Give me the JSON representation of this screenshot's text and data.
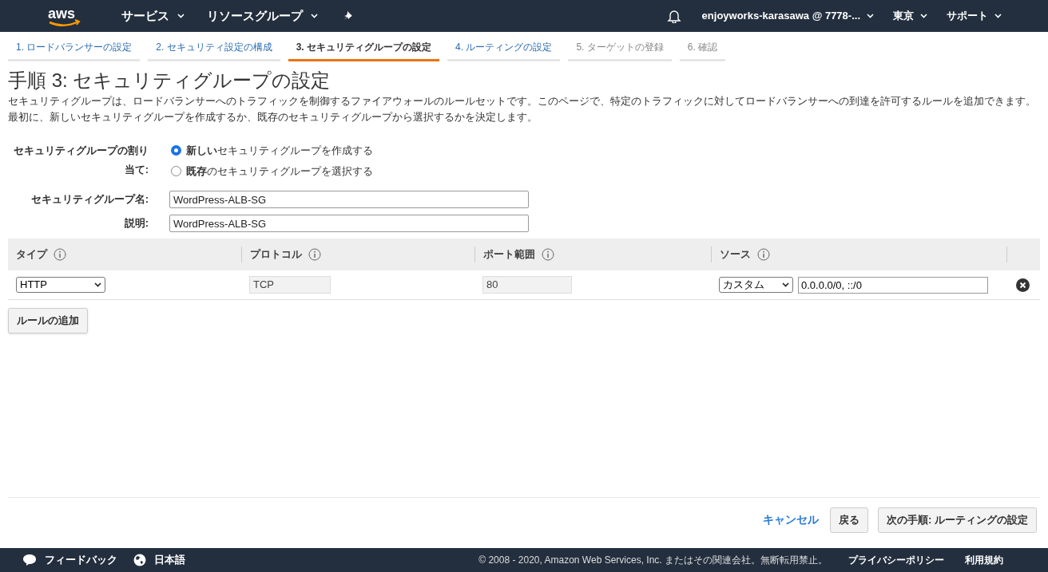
{
  "header": {
    "logo": "aws",
    "nav": [
      {
        "label": "サービス"
      },
      {
        "label": "リソースグループ"
      }
    ],
    "account": "enjoyworks-karasawa @ 7778-...",
    "region": "東京",
    "support": "サポート"
  },
  "steps": [
    {
      "label": "1. ロードバランサーの設定",
      "selected": false,
      "disabled": false
    },
    {
      "label": "2. セキュリティ設定の構成",
      "selected": false,
      "disabled": false
    },
    {
      "label": "3. セキュリティグループの設定",
      "selected": true,
      "disabled": false
    },
    {
      "label": "4. ルーティングの設定",
      "selected": false,
      "disabled": false
    },
    {
      "label": "5. ターゲットの登録",
      "selected": false,
      "disabled": true
    },
    {
      "label": "6. 確認",
      "selected": false,
      "disabled": true
    }
  ],
  "page": {
    "title": "手順 3: セキュリティグループの設定",
    "description": "セキュリティグループは、ロードバランサーへのトラフィックを制御するファイアウォールのルールセットです。このページで、特定のトラフィックに対してロードバランサーへの到達を許可するルールを追加できます。最初に、新しいセキュリティグループを作成するか、既存のセキュリティグループから選択するかを決定します。"
  },
  "assignment": {
    "label": "セキュリティグループの割り当て:",
    "options": [
      {
        "label": "**新しい**セキュリティグループを作成する",
        "selected": true
      },
      {
        "label": "**既存**のセキュリティグループを選択する",
        "selected": false
      }
    ]
  },
  "fields": [
    {
      "label": "セキュリティグループ名:",
      "value": "WordPress-ALB-SG"
    },
    {
      "label": "説明:",
      "value": "WordPress-ALB-SG"
    }
  ],
  "rules": {
    "columns": [
      "タイプ",
      "プロトコル",
      "ポート範囲",
      "ソース"
    ],
    "rows": [
      {
        "type": "HTTP",
        "protocol": "TCP",
        "port": "80",
        "source_kind": "カスタム",
        "source": "0.0.0.0/0, ::/0"
      }
    ],
    "add_button": "ルールの追加"
  },
  "actions": {
    "cancel": "キャンセル",
    "back": "戻る",
    "next": "次の手順: ルーティングの設定"
  },
  "footer": {
    "feedback": "フィードバック",
    "language": "日本語",
    "copyright": "© 2008 - 2020, Amazon Web Services, Inc. またはその関連会社。無断転用禁止。",
    "privacy": "プライバシーポリシー",
    "terms": "利用規約"
  }
}
